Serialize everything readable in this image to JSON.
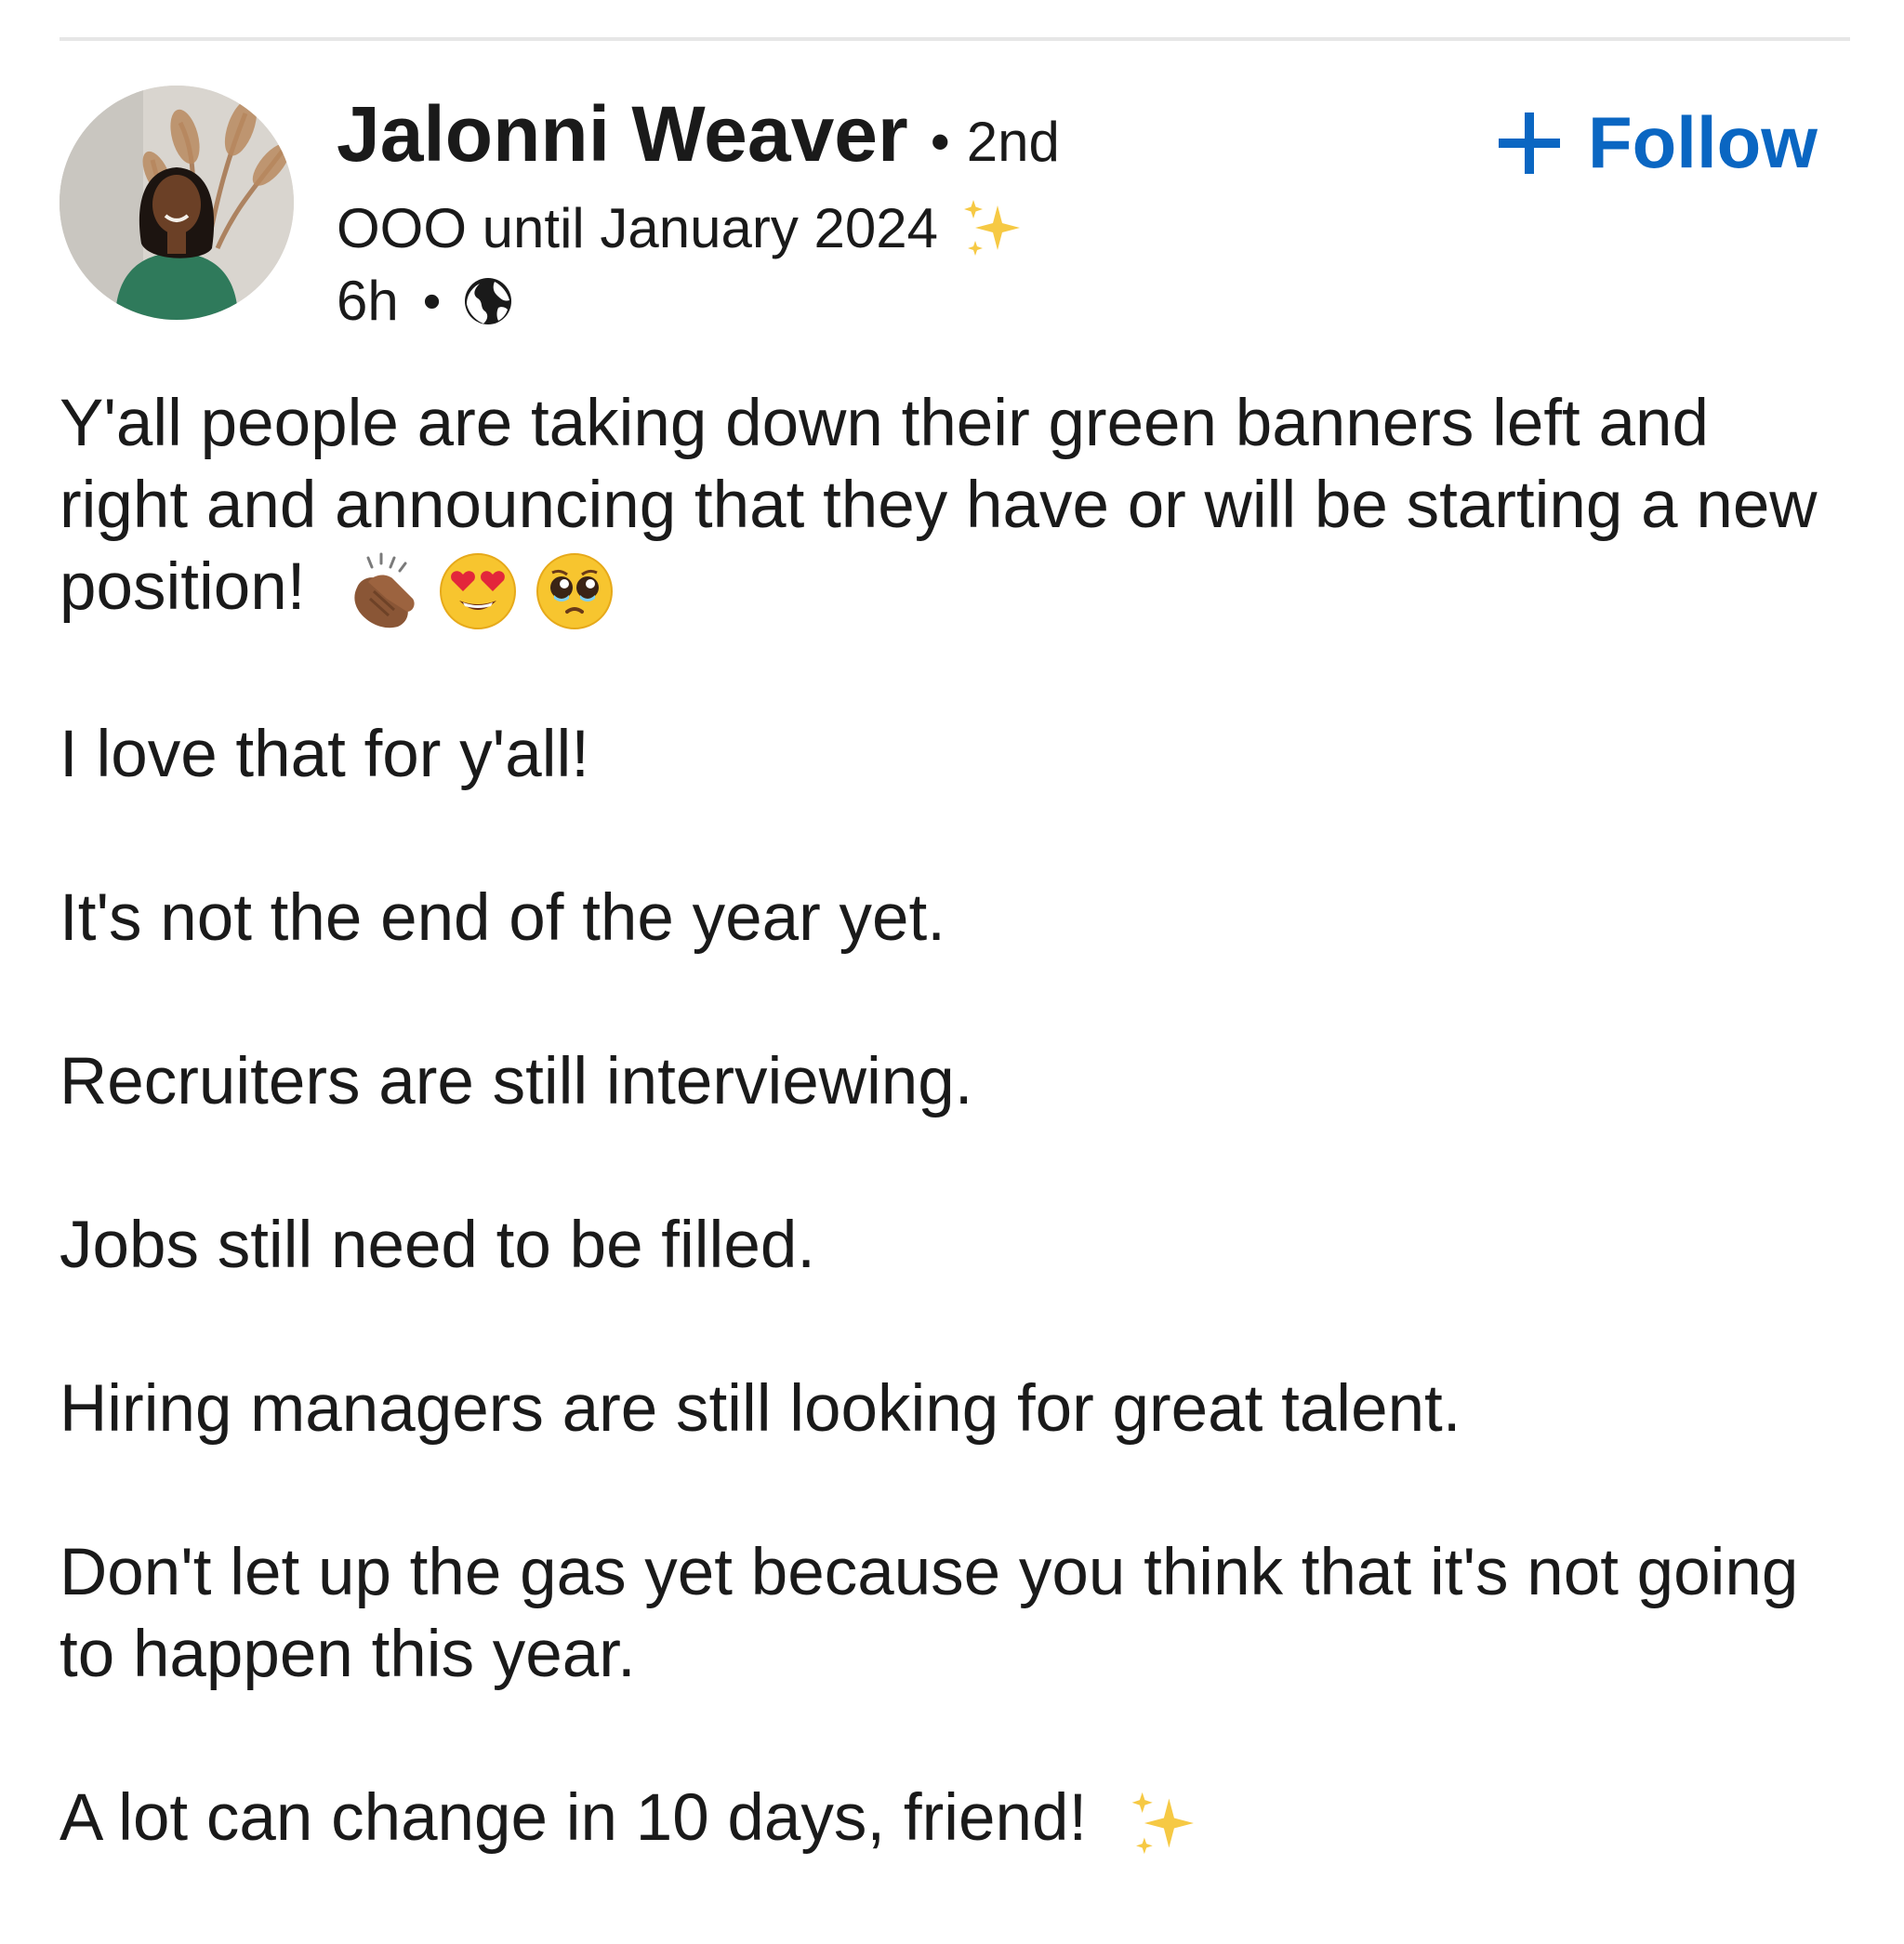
{
  "post": {
    "author": {
      "name": "Jalonni Weaver",
      "degree": "2nd",
      "headline": "OOO until January 2024",
      "headline_icon": "sparkles-icon",
      "timestamp": "6h",
      "visibility_icon": "globe-icon"
    },
    "follow_button": {
      "label": "Follow",
      "icon": "plus-icon",
      "color": "#0a66c2"
    },
    "body": {
      "para1": "Y'all people are taking down their green banners left and right and announcing that they have or will be starting a new position!",
      "para1_emojis": [
        "clapping-hands-icon",
        "heart-eyes-icon",
        "pleading-face-icon"
      ],
      "para2": "I love that for y'all!",
      "para3": "It's not the end of the year yet.",
      "para4": "Recruiters are still interviewing.",
      "para5": "Jobs still need to be filled.",
      "para6": "Hiring managers are still looking for great talent.",
      "para7": "Don't let up the gas yet because you think that it's not going to happen this year.",
      "para8": "A lot can change in 10 days, friend!",
      "para8_icon": "sparkles-icon"
    }
  }
}
